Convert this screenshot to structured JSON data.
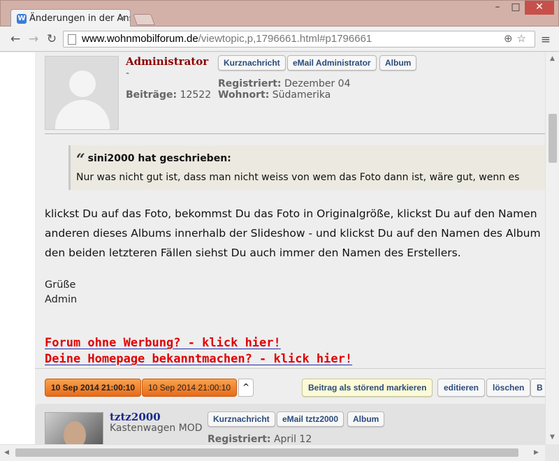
{
  "browser": {
    "tab_title": "Änderungen in der Ansich",
    "url_host": "www.wohnmobilforum.de",
    "url_path": "/viewtopic,p,1796661.html#p1796661",
    "icons": [
      "back-icon",
      "forward-icon",
      "reload-icon",
      "zoom-icon",
      "star-icon",
      "menu-icon"
    ]
  },
  "post1": {
    "username": "Administrator",
    "username_color": "#8b0000",
    "rank": "-",
    "beitraege_label": "Beiträge:",
    "beitraege_value": "12522",
    "buttons": [
      "Kurznachricht",
      "eMail Administrator",
      "Album"
    ],
    "registriert_label": "Registriert:",
    "registriert_value": "Dezember 04",
    "wohnort_label": "Wohnort:",
    "wohnort_value": "Südamerika",
    "quote_author": "sini2000 hat geschrieben:",
    "quote_text": "Nur was nicht gut ist, dass man nicht weiss von wem das Foto dann ist, wäre gut, wenn es",
    "body_lines": [
      "klickst Du auf das Foto, bekommst Du das Foto in Originalgröße, klickst Du auf den Namen",
      "anderen dieses Albums innerhalb der Slideshow - und klickst Du auf den Namen des Album",
      "den beiden letzteren Fällen siehst Du auch immer den Namen des Erstellers."
    ],
    "greeting": "Grüße",
    "signature": "Admin",
    "promo1": "Forum ohne Werbung? - klick hier!",
    "promo2": "Deine Homepage bekanntmachen? - klick hier!",
    "date1": "10 Sep 2014 21:00:10",
    "date2": "10 Sep 2014 21:00:10",
    "up_label": "^",
    "report_label": "Beitrag als störend markieren",
    "edit_label": "editieren",
    "delete_label": "löschen",
    "more_label": "B"
  },
  "post2": {
    "username": "tztz2000",
    "username_color": "#1a2b8a",
    "rank": "Kastenwagen MOD",
    "buttons": [
      "Kurznachricht",
      "eMail tztz2000",
      "Album"
    ],
    "registriert_label": "Registriert:",
    "registriert_value": "April 12"
  },
  "colors": {
    "promo_red": "#e00000",
    "date_orange": "#f08a30"
  }
}
